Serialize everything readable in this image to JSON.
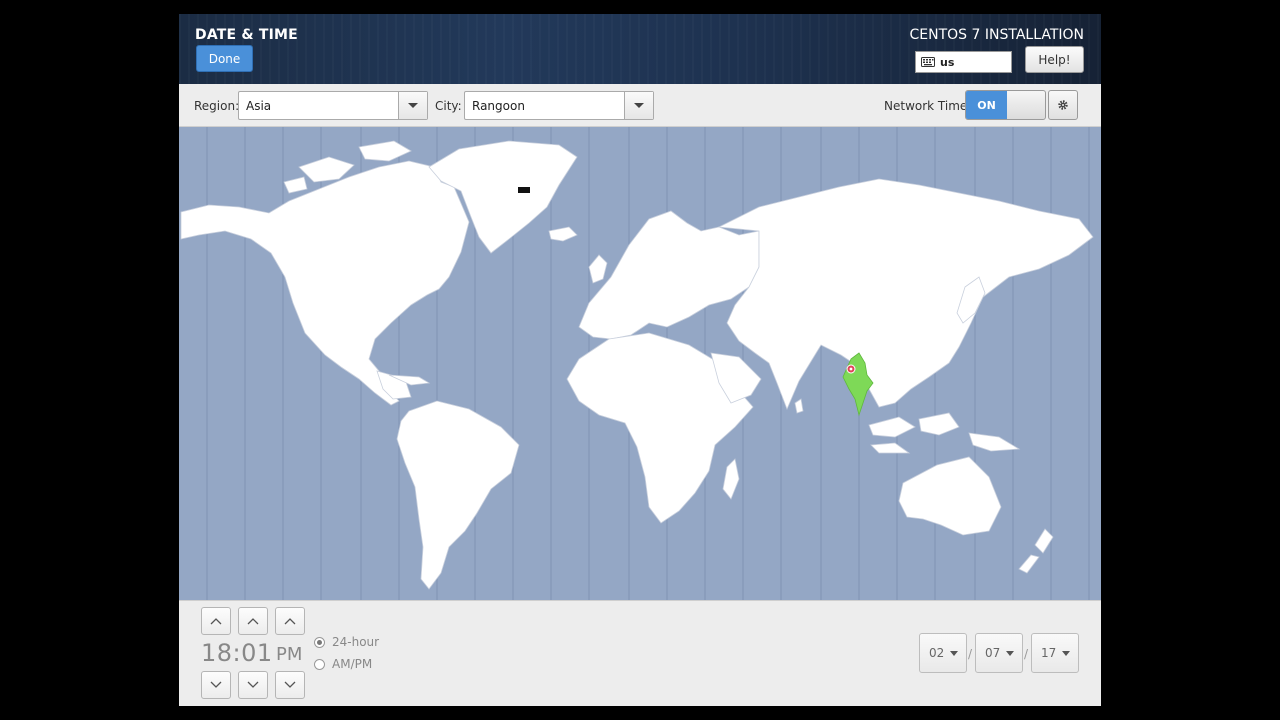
{
  "header": {
    "title": "DATE & TIME",
    "done_label": "Done",
    "product": "CENTOS 7 INSTALLATION",
    "keyboard_layout": "us",
    "help_label": "Help!"
  },
  "toolbar": {
    "region_label": "Region:",
    "region_value": "Asia",
    "city_label": "City:",
    "city_value": "Rangoon",
    "network_time_label": "Network Time",
    "network_time_state": "ON"
  },
  "clock": {
    "time": "18:01",
    "ampm": "PM",
    "format_24": "24-hour",
    "format_12": "AM/PM",
    "selected_format": "24-hour"
  },
  "date": {
    "month": "02",
    "day": "07",
    "year": "17",
    "separator": "/"
  },
  "map": {
    "selected_timezone": "Asia/Rangoon",
    "colors": {
      "ocean": "#94a7c5",
      "land": "#ffffff",
      "highlight": "#7ed957",
      "pin": "#e0455a"
    }
  },
  "colors": {
    "accent": "#4a90d9",
    "header_bg": "#1e3250"
  },
  "icons": {
    "keyboard": "keyboard-icon",
    "settings": "gear-icon",
    "up": "chevron-up-icon",
    "down": "chevron-down-icon"
  }
}
